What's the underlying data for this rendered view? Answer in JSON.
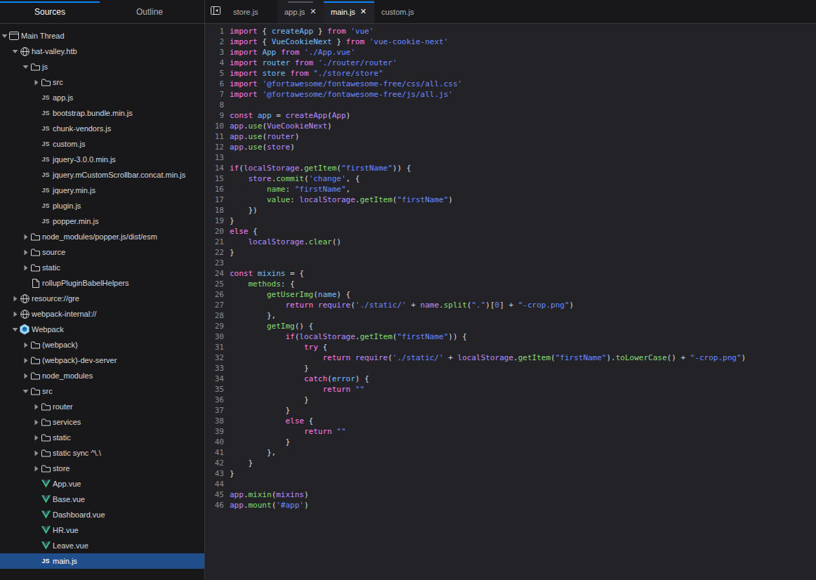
{
  "colors": {
    "accent": "#0a84ff",
    "panel-bg": "#18181a",
    "editor-bg": "#232327",
    "border": "#38383d",
    "selection": "#204e8a",
    "text": "#d7d7db",
    "text-dim": "#b1b1b3",
    "gutter": "#8a8a94",
    "keyword": "#ff7de9",
    "def": "#75bfff",
    "variable": "#b98eff",
    "property": "#86de74",
    "string": "#6b89ff",
    "number": "#6b89ff",
    "punct": "#d7d7db"
  },
  "sidebar": {
    "tabs": [
      {
        "label": "Sources",
        "active": true
      },
      {
        "label": "Outline",
        "active": false
      }
    ],
    "tree": [
      {
        "level": 0,
        "arrow": "down",
        "icon": "window",
        "label": "Main Thread"
      },
      {
        "level": 1,
        "arrow": "down",
        "icon": "globe",
        "label": "hat-valley.htb"
      },
      {
        "level": 2,
        "arrow": "down",
        "icon": "folder",
        "label": "js"
      },
      {
        "level": 3,
        "arrow": "right",
        "icon": "folder",
        "label": "src"
      },
      {
        "level": 3,
        "arrow": "none",
        "icon": "js",
        "label": "app.js"
      },
      {
        "level": 3,
        "arrow": "none",
        "icon": "js",
        "label": "bootstrap.bundle.min.js"
      },
      {
        "level": 3,
        "arrow": "none",
        "icon": "js",
        "label": "chunk-vendors.js"
      },
      {
        "level": 3,
        "arrow": "none",
        "icon": "js",
        "label": "custom.js"
      },
      {
        "level": 3,
        "arrow": "none",
        "icon": "js",
        "label": "jquery-3.0.0.min.js"
      },
      {
        "level": 3,
        "arrow": "none",
        "icon": "js",
        "label": "jquery.mCustomScrollbar.concat.min.js"
      },
      {
        "level": 3,
        "arrow": "none",
        "icon": "js",
        "label": "jquery.min.js"
      },
      {
        "level": 3,
        "arrow": "none",
        "icon": "js",
        "label": "plugin.js"
      },
      {
        "level": 3,
        "arrow": "none",
        "icon": "js",
        "label": "popper.min.js"
      },
      {
        "level": 2,
        "arrow": "right",
        "icon": "folder",
        "label": "node_modules/popper.js/dist/esm"
      },
      {
        "level": 2,
        "arrow": "right",
        "icon": "folder",
        "label": "source"
      },
      {
        "level": 2,
        "arrow": "right",
        "icon": "folder",
        "label": "static"
      },
      {
        "level": 2,
        "arrow": "none",
        "icon": "file",
        "label": "rollupPluginBabelHelpers"
      },
      {
        "level": 1,
        "arrow": "right",
        "icon": "globe",
        "label": "resource://gre"
      },
      {
        "level": 1,
        "arrow": "right",
        "icon": "globe",
        "label": "webpack-internal://"
      },
      {
        "level": 1,
        "arrow": "down",
        "icon": "webpack",
        "label": "Webpack"
      },
      {
        "level": 2,
        "arrow": "right",
        "icon": "folder",
        "label": "(webpack)"
      },
      {
        "level": 2,
        "arrow": "right",
        "icon": "folder",
        "label": "(webpack)-dev-server"
      },
      {
        "level": 2,
        "arrow": "right",
        "icon": "folder",
        "label": "node_modules"
      },
      {
        "level": 2,
        "arrow": "down",
        "icon": "folder",
        "label": "src"
      },
      {
        "level": 3,
        "arrow": "right",
        "icon": "folder",
        "label": "router"
      },
      {
        "level": 3,
        "arrow": "right",
        "icon": "folder",
        "label": "services"
      },
      {
        "level": 3,
        "arrow": "right",
        "icon": "folder",
        "label": "static"
      },
      {
        "level": 3,
        "arrow": "right",
        "icon": "folder",
        "label": "static sync ^\\.\\"
      },
      {
        "level": 3,
        "arrow": "right",
        "icon": "folder",
        "label": "store"
      },
      {
        "level": 3,
        "arrow": "none",
        "icon": "vue",
        "label": "App.vue"
      },
      {
        "level": 3,
        "arrow": "none",
        "icon": "vue",
        "label": "Base.vue"
      },
      {
        "level": 3,
        "arrow": "none",
        "icon": "vue",
        "label": "Dashboard.vue"
      },
      {
        "level": 3,
        "arrow": "none",
        "icon": "vue",
        "label": "HR.vue"
      },
      {
        "level": 3,
        "arrow": "none",
        "icon": "vue",
        "label": "Leave.vue"
      },
      {
        "level": 3,
        "arrow": "none",
        "icon": "js",
        "label": "main.js",
        "selected": true
      }
    ]
  },
  "editor": {
    "tabs": [
      {
        "label": "store.js",
        "close": false,
        "state": "normal",
        "width": 73
      },
      {
        "label": "app.js",
        "close": true,
        "state": "hover",
        "width": 66
      },
      {
        "label": "main.js",
        "close": true,
        "state": "active",
        "width": 72
      },
      {
        "label": "custom.js",
        "close": false,
        "state": "normal",
        "width": 72
      }
    ],
    "lines": [
      [
        [
          "k",
          "import"
        ],
        [
          "t",
          " { "
        ],
        [
          "d",
          "createApp"
        ],
        [
          "t",
          " } "
        ],
        [
          "k",
          "from"
        ],
        [
          "t",
          " "
        ],
        [
          "s",
          "'vue'"
        ]
      ],
      [
        [
          "k",
          "import"
        ],
        [
          "t",
          " { "
        ],
        [
          "d",
          "VueCookieNext"
        ],
        [
          "t",
          " } "
        ],
        [
          "k",
          "from"
        ],
        [
          "t",
          " "
        ],
        [
          "s",
          "'vue-cookie-next'"
        ]
      ],
      [
        [
          "k",
          "import"
        ],
        [
          "t",
          " "
        ],
        [
          "d",
          "App"
        ],
        [
          "t",
          " "
        ],
        [
          "k",
          "from"
        ],
        [
          "t",
          " "
        ],
        [
          "s",
          "'./App.vue'"
        ]
      ],
      [
        [
          "k",
          "import"
        ],
        [
          "t",
          " "
        ],
        [
          "d",
          "router"
        ],
        [
          "t",
          " "
        ],
        [
          "k",
          "from"
        ],
        [
          "t",
          " "
        ],
        [
          "s",
          "'./router/router'"
        ]
      ],
      [
        [
          "k",
          "import"
        ],
        [
          "t",
          " "
        ],
        [
          "d",
          "store"
        ],
        [
          "t",
          " "
        ],
        [
          "k",
          "from"
        ],
        [
          "t",
          " "
        ],
        [
          "s",
          "\"./store/store\""
        ]
      ],
      [
        [
          "k",
          "import"
        ],
        [
          "t",
          " "
        ],
        [
          "s",
          "'@fortawesome/fontawesome-free/css/all.css'"
        ]
      ],
      [
        [
          "k",
          "import"
        ],
        [
          "t",
          " "
        ],
        [
          "s",
          "'@fortawesome/fontawesome-free/js/all.js'"
        ]
      ],
      [],
      [
        [
          "k",
          "const"
        ],
        [
          "t",
          " "
        ],
        [
          "d",
          "app"
        ],
        [
          "t",
          " = "
        ],
        [
          "v",
          "createApp"
        ],
        [
          "t",
          "("
        ],
        [
          "v",
          "App"
        ],
        [
          "t",
          ")"
        ]
      ],
      [
        [
          "v",
          "app"
        ],
        [
          "t",
          "."
        ],
        [
          "p",
          "use"
        ],
        [
          "t",
          "("
        ],
        [
          "v",
          "VueCookieNext"
        ],
        [
          "t",
          ")"
        ]
      ],
      [
        [
          "v",
          "app"
        ],
        [
          "t",
          "."
        ],
        [
          "p",
          "use"
        ],
        [
          "t",
          "("
        ],
        [
          "v",
          "router"
        ],
        [
          "t",
          ")"
        ]
      ],
      [
        [
          "v",
          "app"
        ],
        [
          "t",
          "."
        ],
        [
          "p",
          "use"
        ],
        [
          "t",
          "("
        ],
        [
          "v",
          "store"
        ],
        [
          "t",
          ")"
        ]
      ],
      [],
      [
        [
          "k",
          "if"
        ],
        [
          "t",
          "("
        ],
        [
          "v",
          "localStorage"
        ],
        [
          "t",
          "."
        ],
        [
          "p",
          "getItem"
        ],
        [
          "t",
          "("
        ],
        [
          "s",
          "\"firstName\""
        ],
        [
          "t",
          ")) {"
        ]
      ],
      [
        [
          "t",
          "    "
        ],
        [
          "v",
          "store"
        ],
        [
          "t",
          "."
        ],
        [
          "p",
          "commit"
        ],
        [
          "t",
          "("
        ],
        [
          "s",
          "'change'"
        ],
        [
          "t",
          ", {"
        ]
      ],
      [
        [
          "t",
          "        "
        ],
        [
          "p",
          "name"
        ],
        [
          "t",
          ": "
        ],
        [
          "s",
          "\"firstName\""
        ],
        [
          "t",
          ","
        ]
      ],
      [
        [
          "t",
          "        "
        ],
        [
          "p",
          "value"
        ],
        [
          "t",
          ": "
        ],
        [
          "v",
          "localStorage"
        ],
        [
          "t",
          "."
        ],
        [
          "p",
          "getItem"
        ],
        [
          "t",
          "("
        ],
        [
          "s",
          "\"firstName\""
        ],
        [
          "t",
          ")"
        ]
      ],
      [
        [
          "t",
          "    })"
        ]
      ],
      [
        [
          "t",
          "}"
        ]
      ],
      [
        [
          "k",
          "else"
        ],
        [
          "t",
          " {"
        ]
      ],
      [
        [
          "t",
          "    "
        ],
        [
          "v",
          "localStorage"
        ],
        [
          "t",
          "."
        ],
        [
          "p",
          "clear"
        ],
        [
          "t",
          "()"
        ]
      ],
      [
        [
          "t",
          "}"
        ]
      ],
      [],
      [
        [
          "k",
          "const"
        ],
        [
          "t",
          " "
        ],
        [
          "d",
          "mixins"
        ],
        [
          "t",
          " = {"
        ]
      ],
      [
        [
          "t",
          "    "
        ],
        [
          "p",
          "methods"
        ],
        [
          "t",
          ": {"
        ]
      ],
      [
        [
          "t",
          "        "
        ],
        [
          "p",
          "getUserImg"
        ],
        [
          "t",
          "("
        ],
        [
          "d",
          "name"
        ],
        [
          "t",
          ") {"
        ]
      ],
      [
        [
          "t",
          "            "
        ],
        [
          "k",
          "return"
        ],
        [
          "t",
          " "
        ],
        [
          "v",
          "require"
        ],
        [
          "t",
          "("
        ],
        [
          "s",
          "'./static/'"
        ],
        [
          "t",
          " + "
        ],
        [
          "v",
          "name"
        ],
        [
          "t",
          "."
        ],
        [
          "p",
          "split"
        ],
        [
          "t",
          "("
        ],
        [
          "s",
          "\".\""
        ],
        [
          "t",
          ")["
        ],
        [
          "n",
          "0"
        ],
        [
          "t",
          "] + "
        ],
        [
          "s",
          "\"-crop.png\""
        ],
        [
          "t",
          ")"
        ]
      ],
      [
        [
          "t",
          "        },"
        ]
      ],
      [
        [
          "t",
          "        "
        ],
        [
          "p",
          "getImg"
        ],
        [
          "t",
          "() {"
        ]
      ],
      [
        [
          "t",
          "            "
        ],
        [
          "k",
          "if"
        ],
        [
          "t",
          "("
        ],
        [
          "v",
          "localStorage"
        ],
        [
          "t",
          "."
        ],
        [
          "p",
          "getItem"
        ],
        [
          "t",
          "("
        ],
        [
          "s",
          "\"firstName\""
        ],
        [
          "t",
          ")) {"
        ]
      ],
      [
        [
          "t",
          "                "
        ],
        [
          "k",
          "try"
        ],
        [
          "t",
          " {"
        ]
      ],
      [
        [
          "t",
          "                    "
        ],
        [
          "k",
          "return"
        ],
        [
          "t",
          " "
        ],
        [
          "v",
          "require"
        ],
        [
          "t",
          "("
        ],
        [
          "s",
          "'./static/'"
        ],
        [
          "t",
          " + "
        ],
        [
          "v",
          "localStorage"
        ],
        [
          "t",
          "."
        ],
        [
          "p",
          "getItem"
        ],
        [
          "t",
          "("
        ],
        [
          "s",
          "\"firstName\""
        ],
        [
          "t",
          ")."
        ],
        [
          "p",
          "toLowerCase"
        ],
        [
          "t",
          "() + "
        ],
        [
          "s",
          "\"-crop.png\""
        ],
        [
          "t",
          ")"
        ]
      ],
      [
        [
          "t",
          "                }"
        ]
      ],
      [
        [
          "t",
          "                "
        ],
        [
          "k",
          "catch"
        ],
        [
          "t",
          "("
        ],
        [
          "d",
          "error"
        ],
        [
          "t",
          ") {"
        ]
      ],
      [
        [
          "t",
          "                    "
        ],
        [
          "k",
          "return"
        ],
        [
          "t",
          " "
        ],
        [
          "s",
          "\"\""
        ]
      ],
      [
        [
          "t",
          "                }"
        ]
      ],
      [
        [
          "t",
          "            }"
        ]
      ],
      [
        [
          "t",
          "            "
        ],
        [
          "k",
          "else"
        ],
        [
          "t",
          " {"
        ]
      ],
      [
        [
          "t",
          "                "
        ],
        [
          "k",
          "return"
        ],
        [
          "t",
          " "
        ],
        [
          "s",
          "\"\""
        ]
      ],
      [
        [
          "t",
          "            }"
        ]
      ],
      [
        [
          "t",
          "        },"
        ]
      ],
      [
        [
          "t",
          "    }"
        ]
      ],
      [
        [
          "t",
          "}"
        ]
      ],
      [],
      [
        [
          "v",
          "app"
        ],
        [
          "t",
          "."
        ],
        [
          "p",
          "mixin"
        ],
        [
          "t",
          "("
        ],
        [
          "v",
          "mixins"
        ],
        [
          "t",
          ")"
        ]
      ],
      [
        [
          "v",
          "app"
        ],
        [
          "t",
          "."
        ],
        [
          "p",
          "mount"
        ],
        [
          "t",
          "("
        ],
        [
          "s",
          "'#app'"
        ],
        [
          "t",
          ")"
        ]
      ]
    ]
  }
}
